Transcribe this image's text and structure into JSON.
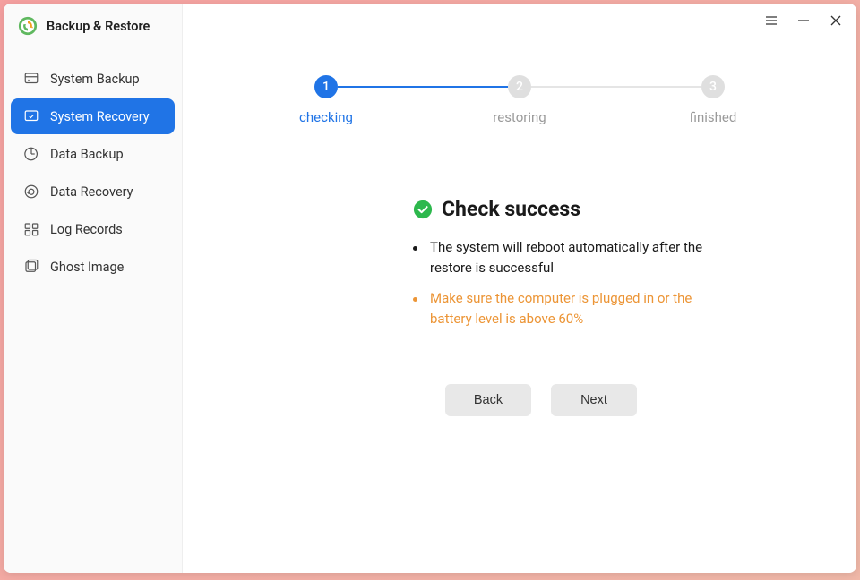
{
  "app": {
    "title": "Backup & Restore"
  },
  "sidebar": {
    "items": [
      {
        "label": "System Backup",
        "name": "sidebar-item-system-backup"
      },
      {
        "label": "System Recovery",
        "name": "sidebar-item-system-recovery"
      },
      {
        "label": "Data Backup",
        "name": "sidebar-item-data-backup"
      },
      {
        "label": "Data Recovery",
        "name": "sidebar-item-data-recovery"
      },
      {
        "label": "Log Records",
        "name": "sidebar-item-log-records"
      },
      {
        "label": "Ghost Image",
        "name": "sidebar-item-ghost-image"
      }
    ],
    "activeIndex": 1
  },
  "wizard": {
    "steps": [
      {
        "num": "1",
        "label": "checking",
        "active": true
      },
      {
        "num": "2",
        "label": "restoring",
        "active": false
      },
      {
        "num": "3",
        "label": "finished",
        "active": false
      }
    ]
  },
  "content": {
    "title": "Check success",
    "messages": [
      {
        "text": "The system will reboot automatically after the restore is successful",
        "type": "normal"
      },
      {
        "text": "Make sure the computer is plugged in or the battery level is above 60%",
        "type": "warning"
      }
    ]
  },
  "buttons": {
    "back": "Back",
    "next": "Next"
  },
  "colors": {
    "accent": "#2074e6",
    "warning": "#ec9536",
    "success": "#2db84d"
  }
}
